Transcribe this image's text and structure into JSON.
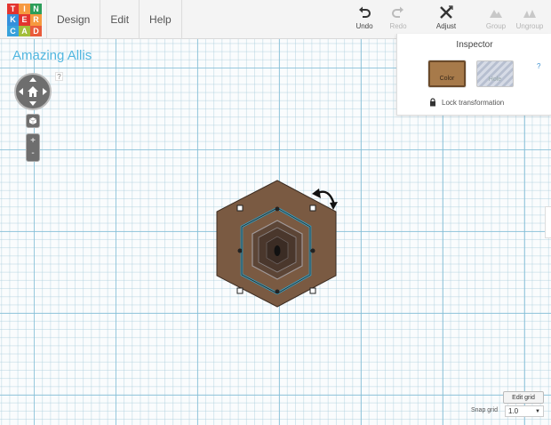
{
  "app": {
    "logo_letters": [
      "TIN",
      "KER",
      "CAD"
    ],
    "logo_colors": [
      "#e3342f",
      "#f6993f",
      "#2d9e5a",
      "#3490dc",
      "#e3342f",
      "#f6993f",
      "#38a1db",
      "#a3be3a",
      "#e95a3a"
    ]
  },
  "menu": {
    "items": [
      "Design",
      "Edit",
      "Help"
    ]
  },
  "toolbar": {
    "undo_label": "Undo",
    "redo_label": "Redo",
    "adjust_label": "Adjust",
    "group_label": "Group",
    "ungroup_label": "Ungroup"
  },
  "design": {
    "title": "Amazing Allis"
  },
  "nav": {
    "help_label": "?",
    "zoom_in_label": "+",
    "zoom_out_label": "-"
  },
  "inspector": {
    "title": "Inspector",
    "color_label": "Color",
    "hole_label": "Hole",
    "help_label": "?",
    "lock_label": "Lock transformation",
    "color_value": "#a77a4a"
  },
  "grid": {
    "edit_label": "Edit grid",
    "snap_label": "Snap grid",
    "snap_value": "1.0"
  },
  "colors": {
    "accent": "#52b7e0",
    "shape_fill": "#7a5a42",
    "selection": "#2ab0e0"
  }
}
